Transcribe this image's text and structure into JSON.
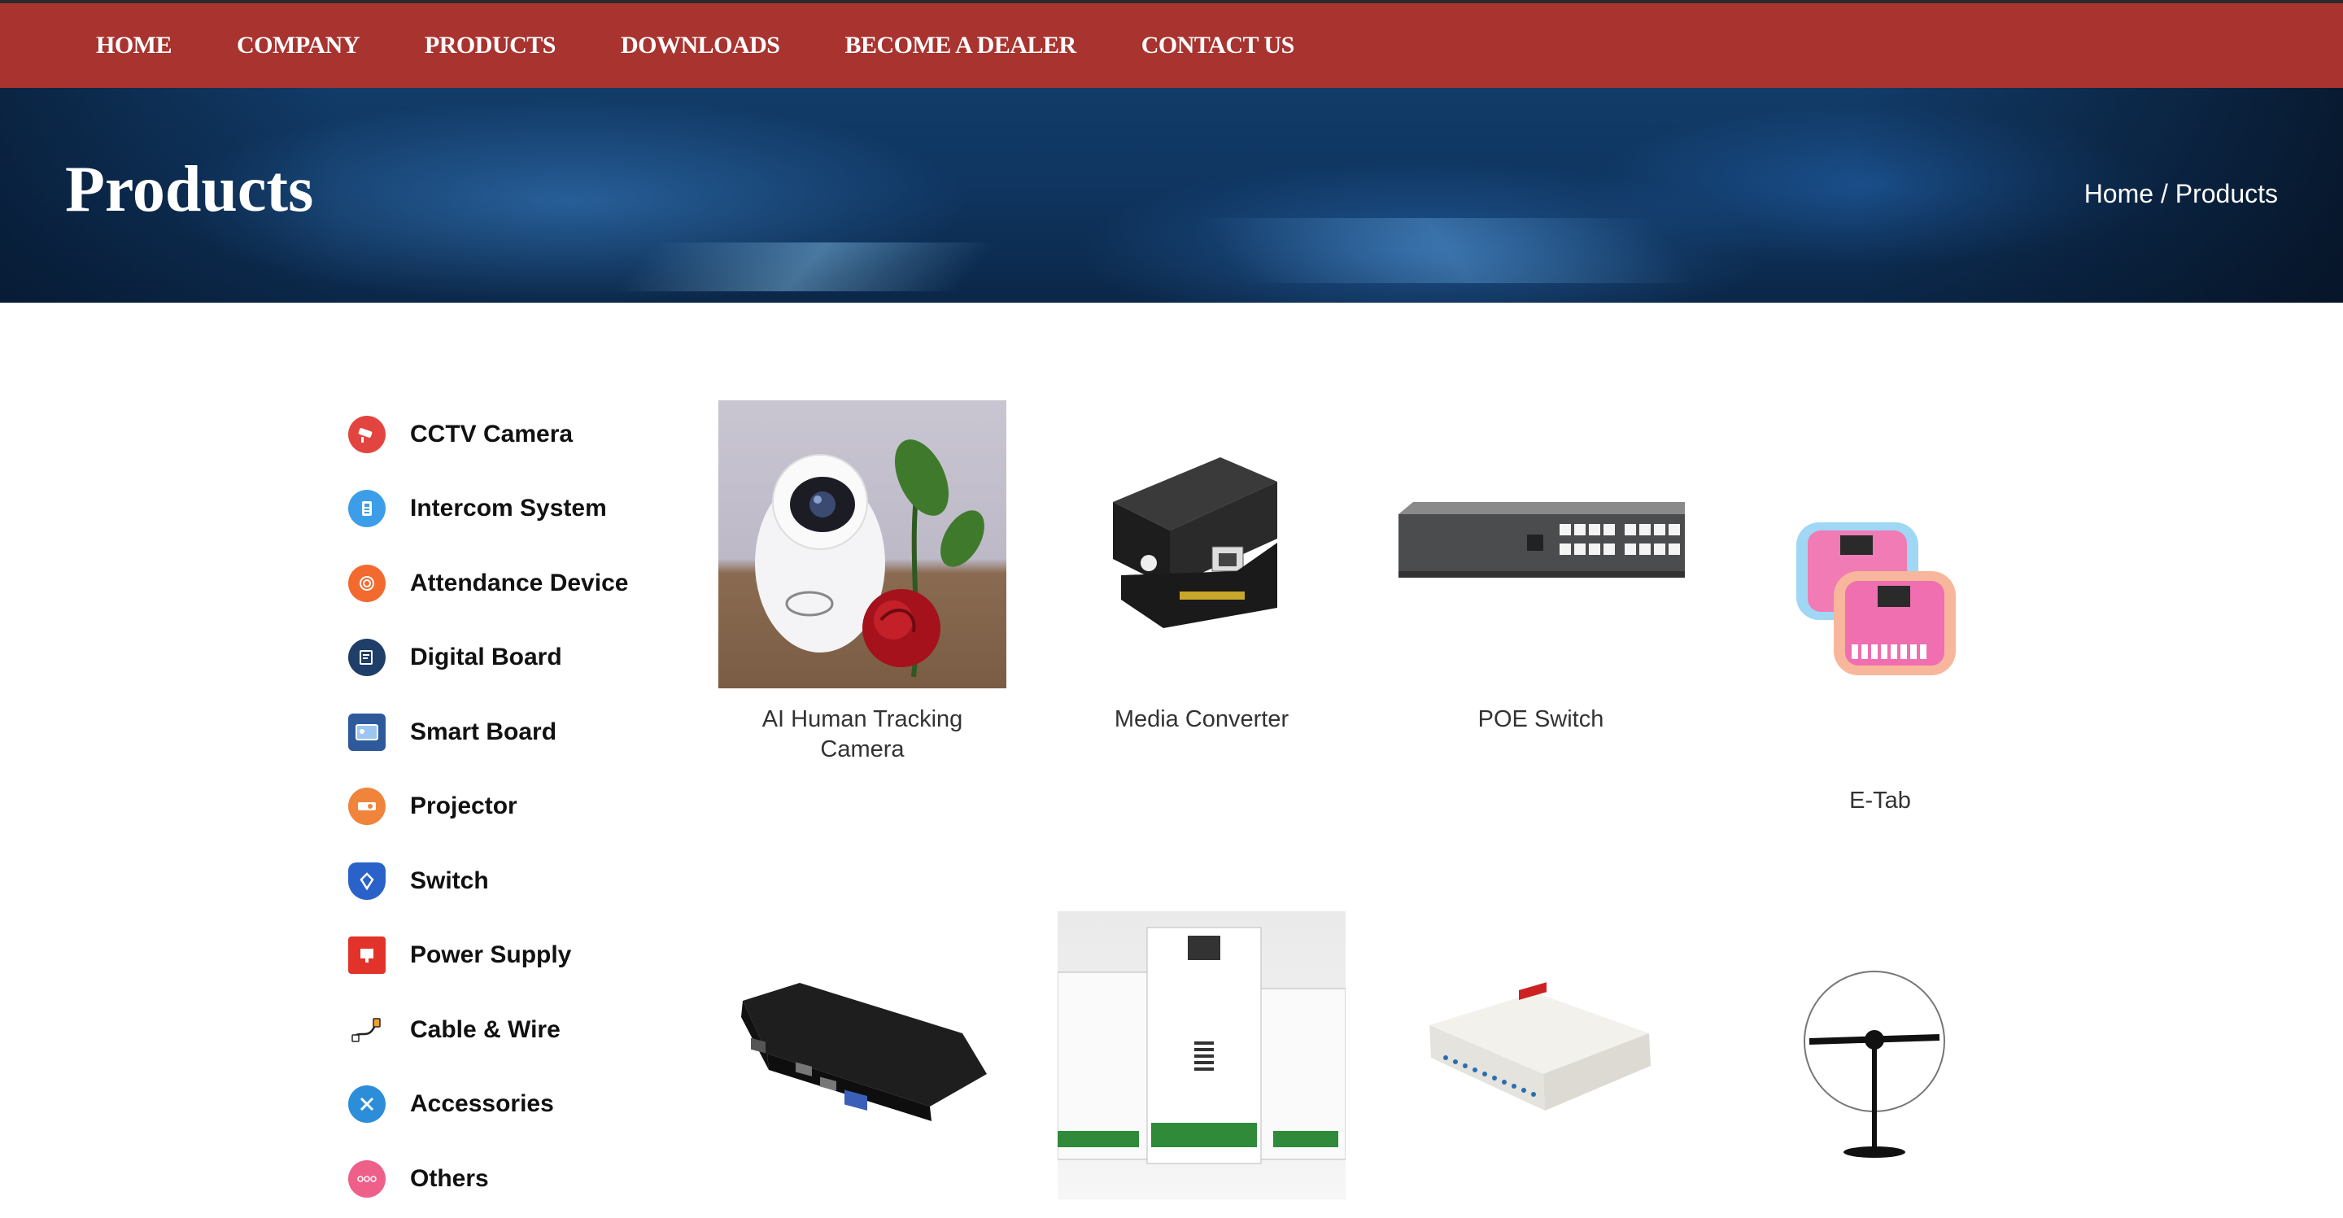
{
  "nav": {
    "items": [
      "HOME",
      "COMPANY",
      "PRODUCTS",
      "DOWNLOADS",
      "BECOME A DEALER",
      "CONTACT US"
    ]
  },
  "hero": {
    "title": "Products",
    "breadcrumb": {
      "home": "Home",
      "separator": " / ",
      "current": "Products"
    }
  },
  "sidebar": {
    "items": [
      {
        "label": "CCTV Camera",
        "icon": "cctv-camera-icon",
        "color": "#e2453f"
      },
      {
        "label": "Intercom System",
        "icon": "intercom-icon",
        "color": "#3c9ee8"
      },
      {
        "label": "Attendance Device",
        "icon": "fingerprint-icon",
        "color": "#f26a2e"
      },
      {
        "label": "Digital Board",
        "icon": "digital-board-icon",
        "color": "#1f3e68"
      },
      {
        "label": "Smart Board",
        "icon": "smart-board-icon",
        "color": "#2e5a9c"
      },
      {
        "label": "Projector",
        "icon": "projector-icon",
        "color": "#f0843b"
      },
      {
        "label": "Switch",
        "icon": "switch-icon",
        "color": "#2a62c9"
      },
      {
        "label": "Power Supply",
        "icon": "power-supply-icon",
        "color": "#e2332b"
      },
      {
        "label": "Cable & Wire",
        "icon": "cable-icon",
        "color": "#333333"
      },
      {
        "label": "Accessories",
        "icon": "tools-icon",
        "color": "#2c8ed8"
      },
      {
        "label": "Others",
        "icon": "more-icon",
        "color": "#ee5f8a"
      }
    ]
  },
  "products": [
    {
      "name": "AI Human Tracking Camera"
    },
    {
      "name": "Media Converter"
    },
    {
      "name": "POE Switch"
    },
    {
      "name": "E-Tab"
    },
    {
      "name": ""
    },
    {
      "name": ""
    },
    {
      "name": ""
    },
    {
      "name": ""
    }
  ],
  "colors": {
    "nav_bg": "#a8332f",
    "hero_bg": "#0f3560"
  }
}
